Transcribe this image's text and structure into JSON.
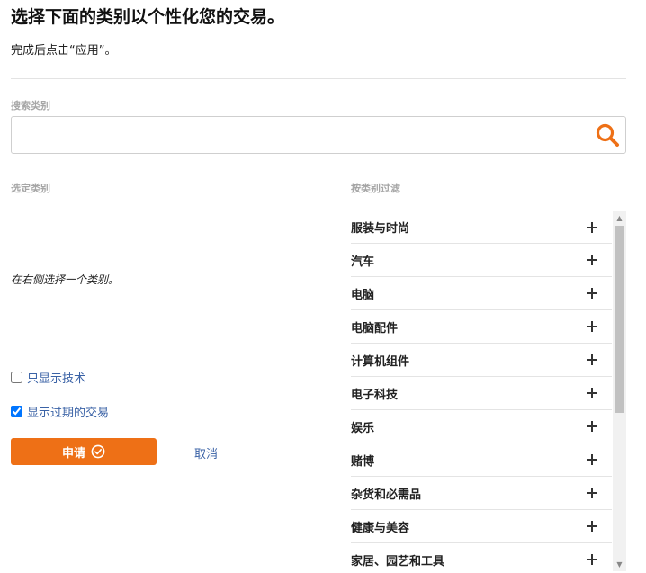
{
  "header": {
    "title": "选择下面的类别以个性化您的交易。",
    "subtitle": "完成后点击“应用”。"
  },
  "search": {
    "label": "搜索类别",
    "value": "",
    "placeholder": ""
  },
  "selected": {
    "label": "选定类别",
    "empty_message": "在右侧选择一个类别。"
  },
  "filter": {
    "label": "按类别过滤",
    "categories": [
      {
        "label": "服装与时尚"
      },
      {
        "label": "汽车"
      },
      {
        "label": "电脑"
      },
      {
        "label": "电脑配件"
      },
      {
        "label": "计算机组件"
      },
      {
        "label": "电子科技"
      },
      {
        "label": "娱乐"
      },
      {
        "label": "赌博"
      },
      {
        "label": "杂货和必需品"
      },
      {
        "label": "健康与美容"
      },
      {
        "label": "家居、园艺和工具"
      }
    ]
  },
  "options": {
    "tech_only": {
      "label": "只显示技术",
      "checked": false
    },
    "show_expired": {
      "label": "显示过期的交易",
      "checked": true
    }
  },
  "actions": {
    "apply_label": "申请",
    "cancel_label": "取消"
  },
  "colors": {
    "accent": "#ee7016",
    "link": "#3a62a6"
  }
}
